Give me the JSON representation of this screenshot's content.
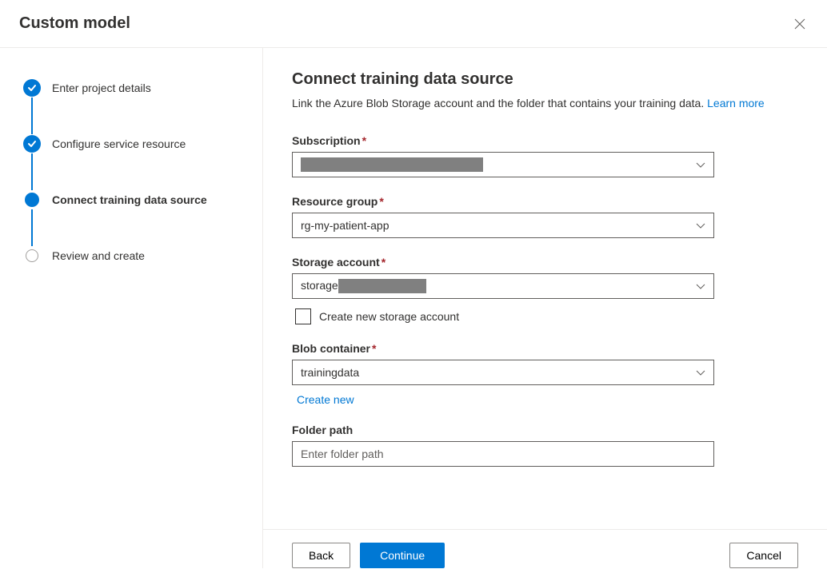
{
  "header": {
    "title": "Custom model"
  },
  "steps": [
    {
      "label": "Enter project details",
      "state": "done"
    },
    {
      "label": "Configure service resource",
      "state": "done"
    },
    {
      "label": "Connect training data source",
      "state": "current"
    },
    {
      "label": "Review and create",
      "state": "pending"
    }
  ],
  "form": {
    "title": "Connect training data source",
    "description": "Link the Azure Blob Storage account and the folder that contains your training data. ",
    "learn_more": "Learn more",
    "fields": {
      "subscription": {
        "label": "Subscription",
        "required": true,
        "value": ""
      },
      "resource_group": {
        "label": "Resource group",
        "required": true,
        "value": "rg-my-patient-app"
      },
      "storage_account": {
        "label": "Storage account",
        "required": true,
        "value_prefix": "storage",
        "checkbox_label": "Create new storage account"
      },
      "blob_container": {
        "label": "Blob container",
        "required": true,
        "value": "trainingdata",
        "create_new": "Create new"
      },
      "folder_path": {
        "label": "Folder path",
        "required": false,
        "placeholder": "Enter folder path",
        "value": ""
      }
    }
  },
  "footer": {
    "back": "Back",
    "continue": "Continue",
    "cancel": "Cancel"
  }
}
